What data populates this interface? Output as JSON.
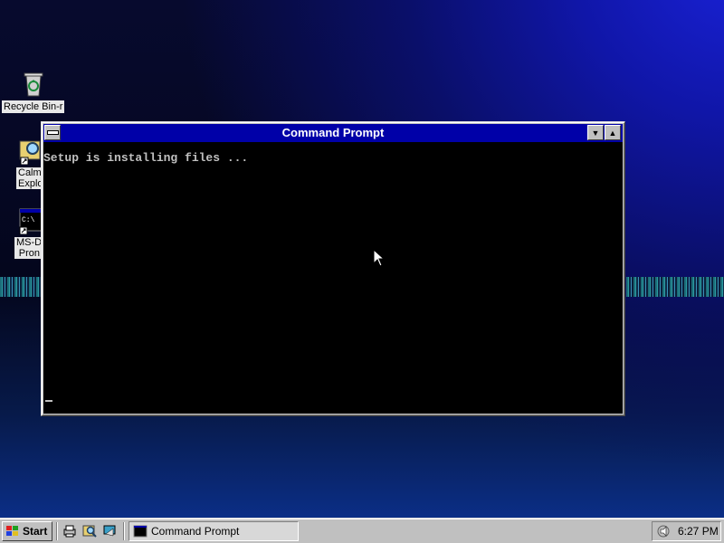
{
  "desktop": {
    "icons": [
      {
        "label": "Recycle Bin-r"
      },
      {
        "label_line1": "Calm",
        "label_line2": "Explo"
      },
      {
        "label_line1": "MS-D",
        "label_line2": "Pron"
      }
    ]
  },
  "window": {
    "title": "Command Prompt",
    "console_line": "Setup is installing files ...",
    "cursor": "_"
  },
  "taskbar": {
    "start_label": "Start",
    "task_label": "Command Prompt",
    "clock": "6:27 PM"
  },
  "colors": {
    "titlebar": "#0000a8",
    "console_bg": "#000000",
    "console_fg": "#c0c0c0",
    "taskbar": "#c0c0c0"
  }
}
